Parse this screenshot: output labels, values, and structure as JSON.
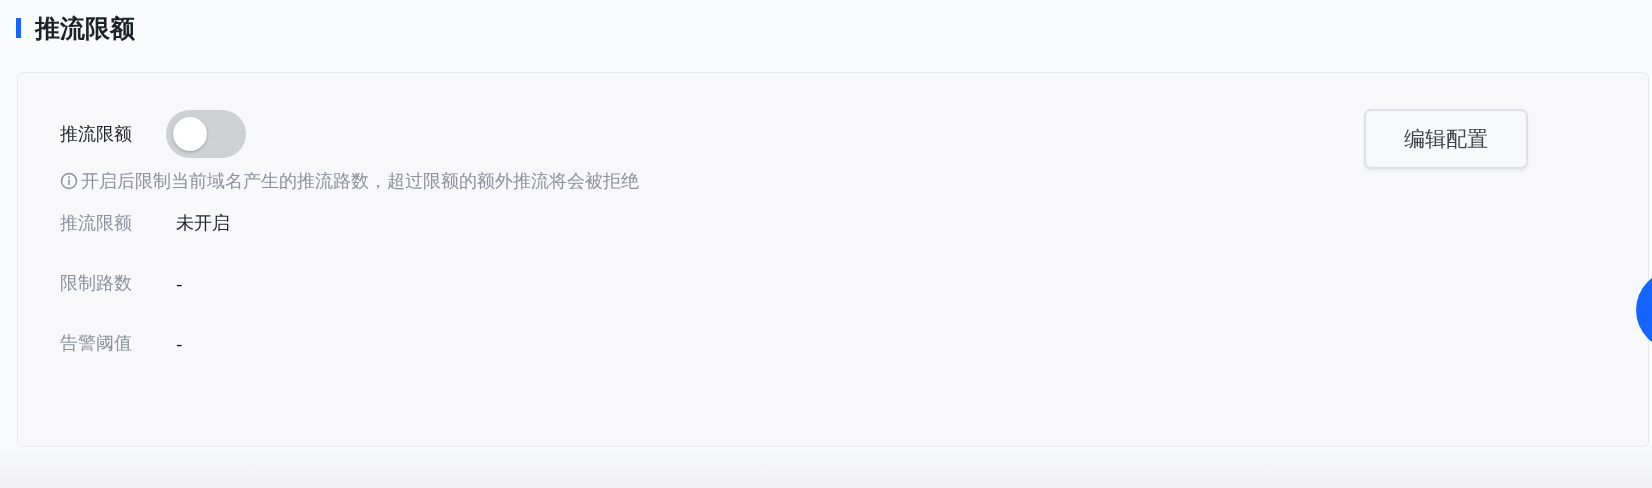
{
  "section": {
    "title": "推流限额"
  },
  "toggle": {
    "label": "推流限额",
    "on": false
  },
  "hint": "开启后限制当前域名产生的推流路数，超过限额的额外推流将会被拒绝",
  "edit_button": "编辑配置",
  "details": [
    {
      "label": "推流限额",
      "value": "未开启"
    },
    {
      "label": "限制路数",
      "value": "-"
    },
    {
      "label": "告警阈值",
      "value": "-"
    }
  ]
}
